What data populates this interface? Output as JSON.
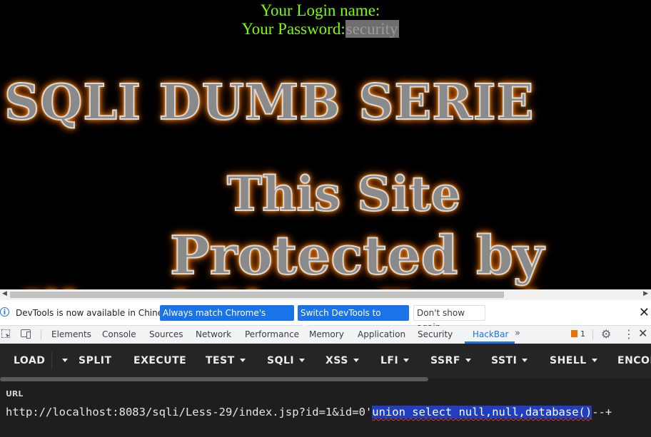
{
  "page": {
    "login_label": "Your Login name:",
    "password_label": "Your Password:",
    "password_value": "security",
    "title": "SQLI DUMB SERIE",
    "protect_line1": "This Site",
    "protect_line2": "Protected by",
    "protect_line3": "Illegal Chars Found"
  },
  "infobar": {
    "message": "DevTools is now available in Chinese!",
    "match_button": "Always match Chrome's language",
    "switch_button": "Switch DevTools to Chinese",
    "dont_show_button": "Don't show again"
  },
  "devtools": {
    "tabs": [
      "Elements",
      "Console",
      "Sources",
      "Network",
      "Performance",
      "Memory",
      "Application",
      "Security",
      "HackBar"
    ],
    "active_tab": "HackBar",
    "issues_count": "1"
  },
  "hackbar": {
    "buttons": {
      "load": "LOAD",
      "split": "SPLIT",
      "execute": "EXECUTE",
      "test": "TEST",
      "sqli": "SQLI",
      "xss": "XSS",
      "lfi": "LFI",
      "ssrf": "SSRF",
      "ssti": "SSTI",
      "shell": "SHELL",
      "encode": "ENCODING"
    },
    "url_label": "URL",
    "url_prefix": "http://localhost:8083/sqli/Less-29/index.jsp?id=1&id=0'",
    "url_selected": "union select null,null,database()",
    "url_suffix": "--+"
  },
  "colors": {
    "login_text": "#7cfc00",
    "glow": "#ff7a00",
    "accent": "#1a73e8",
    "hackbar_bg": "#252525",
    "selection": "#1f3fbf"
  }
}
